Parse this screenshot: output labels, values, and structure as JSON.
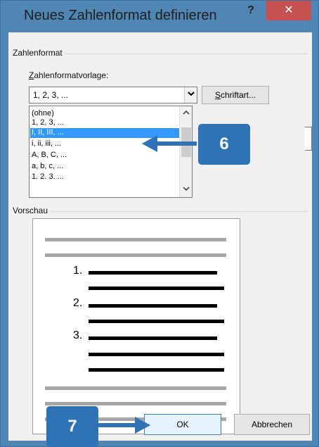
{
  "dialog": {
    "title": "Neues Zahlenformat definieren",
    "help_label": "?",
    "close_label": "✕"
  },
  "format_group": {
    "label": "Zahlenformat",
    "template_label_u": "Z",
    "template_label_rest": "ahlenformatvorlage:",
    "combo_value": "1, 2, 3, ...",
    "combo_arrow": "⌄",
    "font_button_u": "S",
    "font_button_rest": "chriftart...",
    "list_items": [
      "(ohne)",
      "1, 2, 3, ...",
      "I, II, III, ...",
      "i, ii, iii, ...",
      "A, B, C, ...",
      "a, b, c, ...",
      "1. 2. 3. ..."
    ],
    "selected_index": 2,
    "scroll_up": "⌃",
    "scroll_down": "⌄"
  },
  "preview_group": {
    "label": "Vorschau",
    "numbers": [
      "1.",
      "2.",
      "3."
    ]
  },
  "buttons": {
    "ok": "OK",
    "cancel": "Abbrechen"
  },
  "callouts": {
    "step6": "6",
    "step7": "7"
  },
  "colors": {
    "window_border": "#4f86b3",
    "close_button": "#c75050",
    "selection": "#3399ff",
    "callout": "#2e74b5"
  }
}
